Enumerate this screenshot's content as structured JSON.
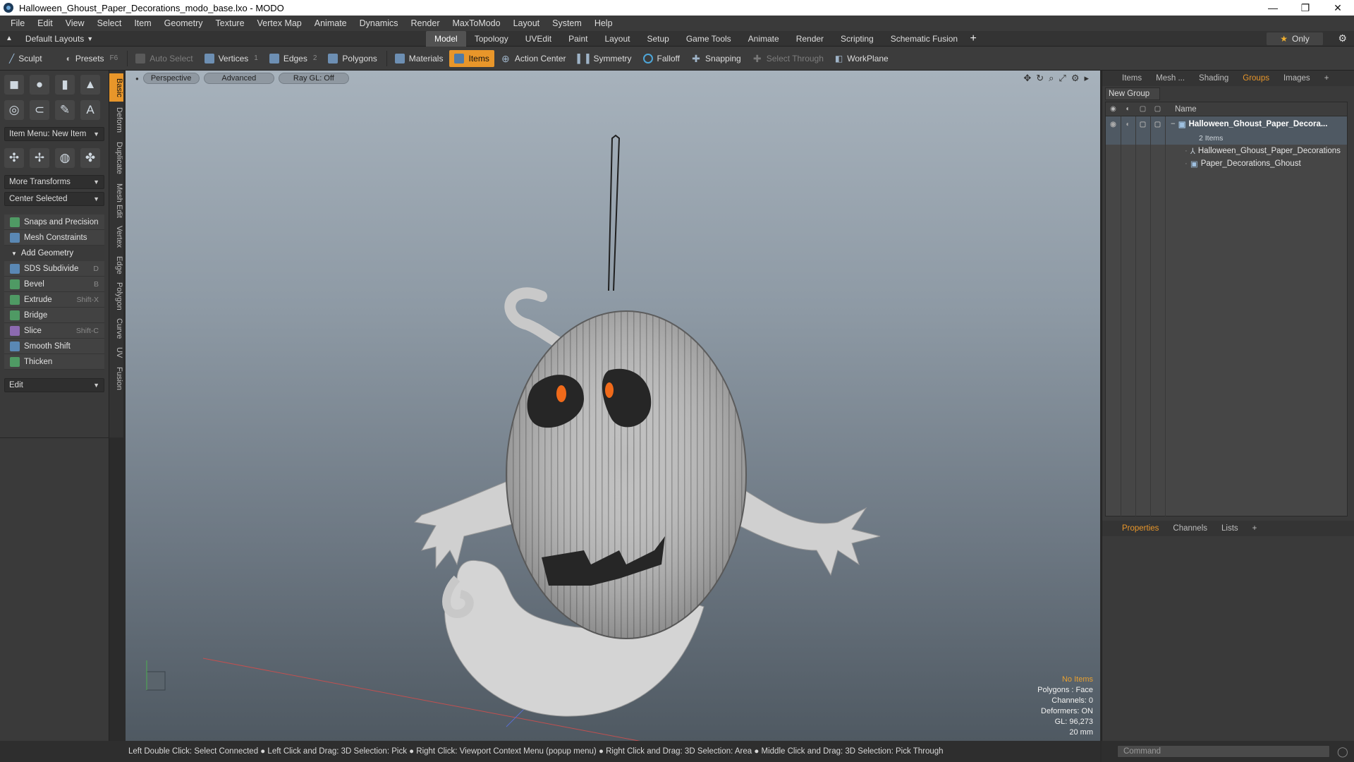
{
  "window": {
    "title": "Halloween_Ghoust_Paper_Decorations_modo_base.lxo - MODO",
    "minimize": "—",
    "restore": "❐",
    "close": "✕"
  },
  "menu": [
    "File",
    "Edit",
    "View",
    "Select",
    "Item",
    "Geometry",
    "Texture",
    "Vertex Map",
    "Animate",
    "Dynamics",
    "Render",
    "MaxToModo",
    "Layout",
    "System",
    "Help"
  ],
  "layout_bar": {
    "default_layouts": "Default Layouts",
    "tabs": [
      "Model",
      "Topology",
      "UVEdit",
      "Paint",
      "Layout",
      "Setup",
      "Game Tools",
      "Animate",
      "Render",
      "Scripting",
      "Schematic Fusion"
    ],
    "active_tab": "Model",
    "plus": "+",
    "only_label": "Only"
  },
  "toolbar": {
    "sculpt": "Sculpt",
    "presets": "Presets",
    "presets_key": "F6",
    "auto_select": "Auto Select",
    "vertices": "Vertices",
    "vertices_key": "1",
    "edges": "Edges",
    "edges_key": "2",
    "polygons": "Polygons",
    "materials": "Materials",
    "items": "Items",
    "action_center": "Action Center",
    "symmetry": "Symmetry",
    "falloff": "Falloff",
    "snapping": "Snapping",
    "select_through": "Select Through",
    "workplane": "WorkPlane"
  },
  "left_panel": {
    "item_menu": "Item Menu: New Item",
    "more_transforms": "More Transforms",
    "center_selected": "Center Selected",
    "snaps": "Snaps and Precision",
    "mesh_constraints": "Mesh Constraints",
    "add_geometry": "Add Geometry",
    "tools": [
      {
        "label": "SDS Subdivide",
        "key": "D"
      },
      {
        "label": "Bevel",
        "key": "B"
      },
      {
        "label": "Extrude",
        "key": "Shift-X"
      },
      {
        "label": "Bridge",
        "key": ""
      },
      {
        "label": "Slice",
        "key": "Shift-C"
      },
      {
        "label": "Smooth Shift",
        "key": ""
      },
      {
        "label": "Thicken",
        "key": ""
      }
    ],
    "edit": "Edit",
    "vertical_tabs": [
      "Basic",
      "Deform",
      "Duplicate",
      "Mesh Edit",
      "Vertex",
      "Edge",
      "Polygon",
      "Curve",
      "UV",
      "Fusion"
    ]
  },
  "viewport": {
    "perspective": "Perspective",
    "advanced": "Advanced",
    "raygl": "Ray GL: Off",
    "hud": {
      "no_items": "No Items",
      "polygons": "Polygons : Face",
      "channels": "Channels: 0",
      "deformers": "Deformers: ON",
      "gl": "GL: 96,273",
      "scale": "20 mm"
    }
  },
  "status_bar": "Left Double Click: Select Connected ● Left Click and Drag: 3D Selection: Pick ● Right Click: Viewport Context Menu (popup menu) ● Right Click and Drag: 3D Selection: Area ● Middle Click and Drag: 3D Selection: Pick Through",
  "right_panel": {
    "tabs": [
      "Items",
      "Mesh ...",
      "Shading",
      "Groups",
      "Images"
    ],
    "active_tab": "Groups",
    "new_group": "New Group",
    "name_header": "Name",
    "group_name": "Halloween_Ghoust_Paper_Decora...",
    "group_count": "2 Items",
    "children": [
      "Halloween_Ghoust_Paper_Decorations",
      "Paper_Decorations_Ghoust"
    ],
    "bottom_tabs": [
      "Properties",
      "Channels",
      "Lists"
    ],
    "bottom_active": "Properties",
    "command_placeholder": "Command"
  },
  "colors": {
    "accent": "#e8962a",
    "viewport_top": "#a7b2bc",
    "viewport_bottom": "#4f5962"
  }
}
